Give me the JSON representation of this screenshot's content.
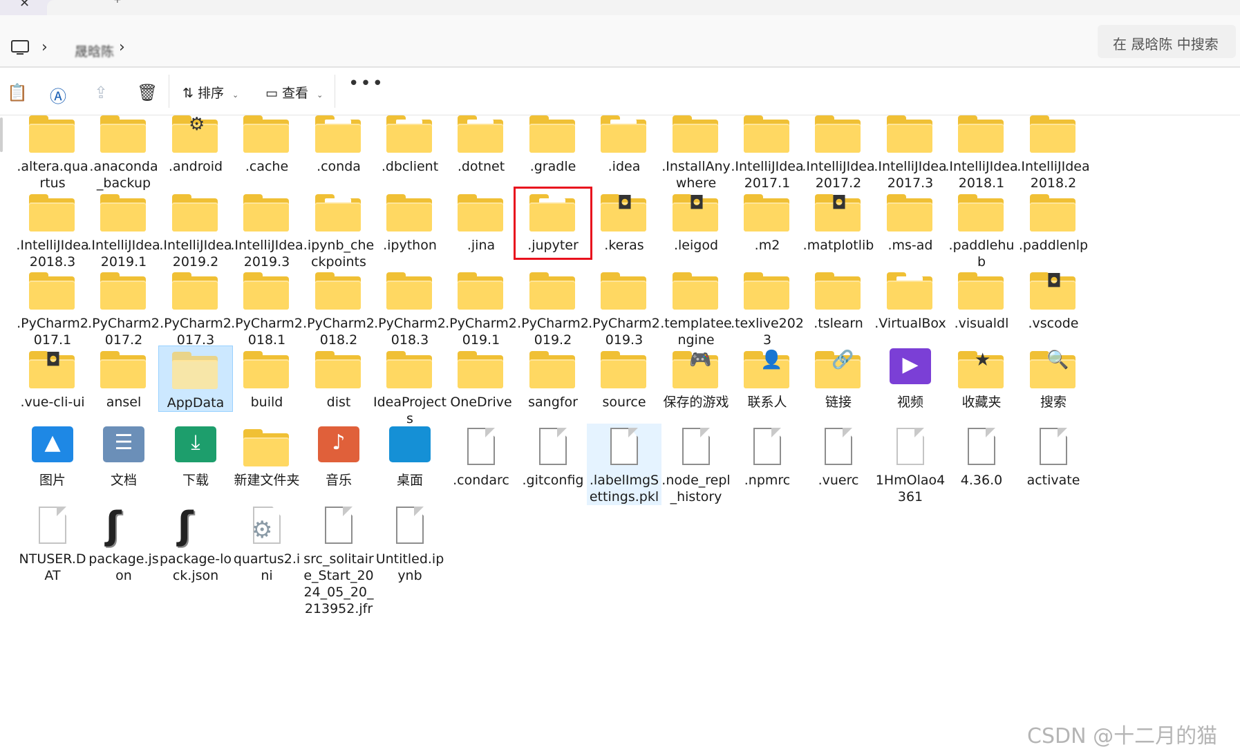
{
  "window": {
    "tab_close_glyph": "✕",
    "tab_new_glyph": "+"
  },
  "address": {
    "separator": "›",
    "current_user": "晟晗陈",
    "search_placeholder": "在 晟晗陈 中搜索"
  },
  "toolbar": {
    "sort_label": "排序",
    "view_label": "查看",
    "more_glyph": "•••"
  },
  "items": [
    {
      "label": ".altera.quartus",
      "kind": "folder"
    },
    {
      "label": ".anaconda_backup",
      "kind": "folder"
    },
    {
      "label": ".android",
      "kind": "folder-badge",
      "badge": "⚙"
    },
    {
      "label": ".cache",
      "kind": "folder"
    },
    {
      "label": ".conda",
      "kind": "folder-paper"
    },
    {
      "label": ".dbclient",
      "kind": "folder-paper"
    },
    {
      "label": ".dotnet",
      "kind": "folder-paper"
    },
    {
      "label": ".gradle",
      "kind": "folder"
    },
    {
      "label": ".idea",
      "kind": "folder-paper"
    },
    {
      "label": ".InstallAnywhere",
      "kind": "folder"
    },
    {
      "label": ".IntelliJIdea2017.1",
      "kind": "folder"
    },
    {
      "label": ".IntelliJIdea2017.2",
      "kind": "folder"
    },
    {
      "label": ".IntelliJIdea2017.3",
      "kind": "folder"
    },
    {
      "label": ".IntelliJIdea2018.1",
      "kind": "folder"
    },
    {
      "label": ".IntelliJIdea2018.2",
      "kind": "folder"
    },
    {
      "label": ".IntelliJIdea2018.3",
      "kind": "folder"
    },
    {
      "label": ".IntelliJIdea2019.1",
      "kind": "folder"
    },
    {
      "label": ".IntelliJIdea2019.2",
      "kind": "folder"
    },
    {
      "label": ".IntelliJIdea2019.3",
      "kind": "folder"
    },
    {
      "label": ".ipynb_checkpoints",
      "kind": "folder-paper"
    },
    {
      "label": ".ipython",
      "kind": "folder"
    },
    {
      "label": ".jina",
      "kind": "folder"
    },
    {
      "label": ".jupyter",
      "kind": "folder-paper",
      "highlight": true
    },
    {
      "label": ".keras",
      "kind": "folder-badge",
      "badge": "◘"
    },
    {
      "label": ".leigod",
      "kind": "folder-badge",
      "badge": "◘"
    },
    {
      "label": ".m2",
      "kind": "folder"
    },
    {
      "label": ".matplotlib",
      "kind": "folder-badge",
      "badge": "◘"
    },
    {
      "label": ".ms-ad",
      "kind": "folder"
    },
    {
      "label": ".paddlehub",
      "kind": "folder"
    },
    {
      "label": ".paddlenlp",
      "kind": "folder"
    },
    {
      "label": ".PyCharm2017.1",
      "kind": "folder"
    },
    {
      "label": ".PyCharm2017.2",
      "kind": "folder"
    },
    {
      "label": ".PyCharm2017.3",
      "kind": "folder"
    },
    {
      "label": ".PyCharm2018.1",
      "kind": "folder"
    },
    {
      "label": ".PyCharm2018.2",
      "kind": "folder"
    },
    {
      "label": ".PyCharm2018.3",
      "kind": "folder"
    },
    {
      "label": ".PyCharm2019.1",
      "kind": "folder"
    },
    {
      "label": ".PyCharm2019.2",
      "kind": "folder"
    },
    {
      "label": ".PyCharm2019.3",
      "kind": "folder"
    },
    {
      "label": ".templateengine",
      "kind": "folder"
    },
    {
      "label": ".texlive2023",
      "kind": "folder"
    },
    {
      "label": ".tslearn",
      "kind": "folder"
    },
    {
      "label": ".VirtualBox",
      "kind": "folder-paper"
    },
    {
      "label": ".visualdl",
      "kind": "folder"
    },
    {
      "label": ".vscode",
      "kind": "folder-badge",
      "badge": "◘"
    },
    {
      "label": ".vue-cli-ui",
      "kind": "folder-badge",
      "badge": "◘"
    },
    {
      "label": "ansel",
      "kind": "folder"
    },
    {
      "label": "AppData",
      "kind": "folder-light",
      "selected": true
    },
    {
      "label": "build",
      "kind": "folder"
    },
    {
      "label": "dist",
      "kind": "folder"
    },
    {
      "label": "IdeaProjects",
      "kind": "folder"
    },
    {
      "label": "OneDrive",
      "kind": "folder"
    },
    {
      "label": "sangfor",
      "kind": "folder"
    },
    {
      "label": "source",
      "kind": "folder"
    },
    {
      "label": "保存的游戏",
      "kind": "folder-badge",
      "badge": "🎮"
    },
    {
      "label": "联系人",
      "kind": "folder-badge",
      "badge": "👤"
    },
    {
      "label": "链接",
      "kind": "folder-badge",
      "badge": "🔗"
    },
    {
      "label": "视频",
      "kind": "app",
      "color": "#7b3fd6",
      "glyph": "▶"
    },
    {
      "label": "收藏夹",
      "kind": "folder-badge",
      "badge": "★"
    },
    {
      "label": "搜索",
      "kind": "folder-badge",
      "badge": "🔍"
    },
    {
      "label": "图片",
      "kind": "app",
      "color": "#1e88e5",
      "glyph": "▲"
    },
    {
      "label": "文档",
      "kind": "app",
      "color": "#6b8fb8",
      "glyph": "☰"
    },
    {
      "label": "下载",
      "kind": "app",
      "color": "#1d9e6c",
      "glyph": "⤓"
    },
    {
      "label": "新建文件夹",
      "kind": "folder"
    },
    {
      "label": "音乐",
      "kind": "app",
      "color": "#e0603a",
      "glyph": "♪"
    },
    {
      "label": "桌面",
      "kind": "app",
      "color": "#1590d6",
      "glyph": ""
    },
    {
      "label": ".condarc",
      "kind": "file"
    },
    {
      "label": ".gitconfig",
      "kind": "file"
    },
    {
      "label": ".labelImgSettings.pkl",
      "kind": "file",
      "hover": true
    },
    {
      "label": ".node_repl_history",
      "kind": "file"
    },
    {
      "label": ".npmrc",
      "kind": "file"
    },
    {
      "label": ".vuerc",
      "kind": "file"
    },
    {
      "label": "1HmOlao4361",
      "kind": "file-light"
    },
    {
      "label": "4.36.0",
      "kind": "file"
    },
    {
      "label": "activate",
      "kind": "file"
    },
    {
      "label": "NTUSER.DAT",
      "kind": "file-light"
    },
    {
      "label": "package.json",
      "kind": "jlogo"
    },
    {
      "label": "package-lock.json",
      "kind": "jlogo"
    },
    {
      "label": "quartus2.ini",
      "kind": "ini"
    },
    {
      "label": "src_solitaire_Start_2024_05_20_213952.jfr",
      "kind": "file"
    },
    {
      "label": "Untitled.ipynb",
      "kind": "file"
    }
  ],
  "watermark": "CSDN @十二月的猫"
}
